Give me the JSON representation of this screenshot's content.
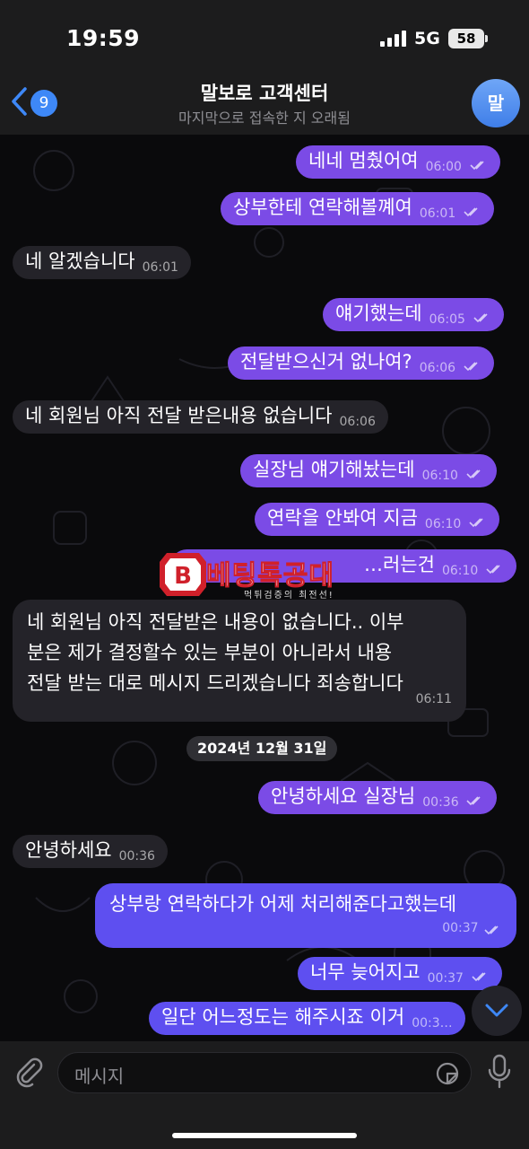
{
  "status_bar": {
    "time": "19:59",
    "network": "5G",
    "battery": "58"
  },
  "header": {
    "back_count": "9",
    "title": "말보로 고객센터",
    "subtitle": "마지막으로 접속한 지 오래됨",
    "avatar_initial": "말"
  },
  "messages": [
    {
      "dir": "out",
      "text": "네네 멈췄어여",
      "time": "06:00"
    },
    {
      "dir": "out",
      "text": "상부한테 연락해볼꼐여",
      "time": "06:01"
    },
    {
      "dir": "in",
      "text": "네 알겠습니다",
      "time": "06:01"
    },
    {
      "dir": "out",
      "text": "얘기했는데",
      "time": "06:05"
    },
    {
      "dir": "out",
      "text": "전달받으신거 없나여?",
      "time": "06:06"
    },
    {
      "dir": "in",
      "text": "네 회원님 아직 전달 받은내용 없습니다",
      "time": "06:06"
    },
    {
      "dir": "out",
      "text": "실장님 얘기해놨는데",
      "time": "06:10"
    },
    {
      "dir": "out",
      "text": "연락을 안봐여 지금",
      "time": "06:10"
    },
    {
      "dir": "out",
      "text": "…러는건",
      "time": "06:10"
    },
    {
      "dir": "in",
      "lines": [
        "네 회원님 아직 전달받은 내용이 없습니다.. 이부",
        "분은 제가 결정할수 있는 부분이 아니라서 내용",
        "전달 받는 대로 메시지 드리겠습니다 죄송합니다"
      ],
      "time": "06:11"
    },
    {
      "dir": "out",
      "text": "안녕하세요 실장님",
      "time": "00:36"
    },
    {
      "dir": "in",
      "text": "안녕하세요",
      "time": "00:36"
    },
    {
      "dir": "out",
      "text": "상부랑 연락하다가 어제 처리해준다고했는데",
      "time": "00:37"
    },
    {
      "dir": "out",
      "text": "너무 늦어지고",
      "time": "00:37"
    },
    {
      "dir": "out",
      "text": "일단 어느정도는 해주시죠 이거",
      "time": "00:3…"
    }
  ],
  "date_divider": "2024년 12월 31일",
  "watermark": {
    "name": "베팅톡공대",
    "tagline": "먹튀검증의 최전선!"
  },
  "input": {
    "placeholder": "메시지"
  },
  "colors": {
    "outgoing": "#7b4be6",
    "incoming": "#242329",
    "accent": "#3e88f7"
  },
  "icons": [
    "chevron-left-icon",
    "paperclip-icon",
    "sticker-icon",
    "microphone-icon",
    "chevron-down-icon",
    "double-check-icon"
  ]
}
